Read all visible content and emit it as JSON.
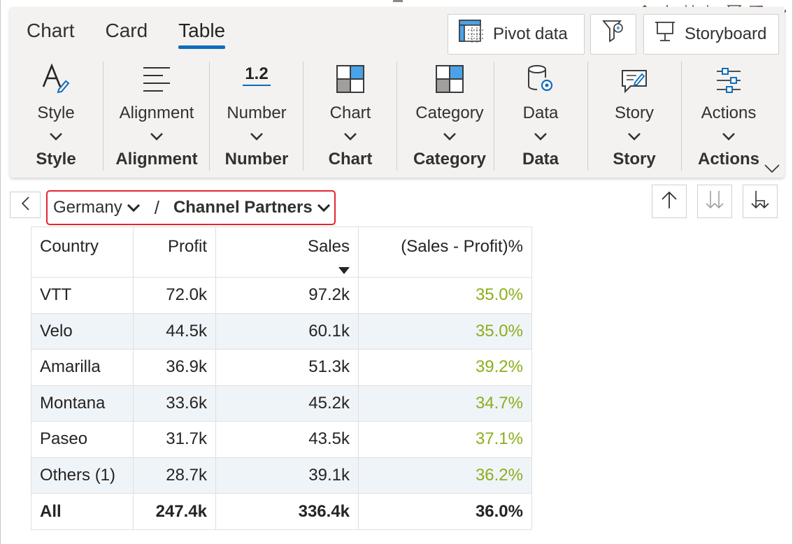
{
  "tabs": [
    {
      "label": "Chart"
    },
    {
      "label": "Card"
    },
    {
      "label": "Table"
    }
  ],
  "toolbar": {
    "pivot_label": "Pivot  data",
    "storyboard_label": "Storyboard"
  },
  "groups": [
    {
      "label": "Style",
      "name": "Style",
      "icon": "style-pen-icon"
    },
    {
      "label": "Alignment",
      "name": "Alignment",
      "icon": "align-left-icon"
    },
    {
      "label": "Number",
      "name": "Number",
      "icon_text": "1.2"
    },
    {
      "label": "Chart",
      "name": "Chart",
      "icon": "grid-chart-icon"
    },
    {
      "label": "Category",
      "name": "Category",
      "icon": "grid-category-icon"
    },
    {
      "label": "Data",
      "name": "Data",
      "icon": "database-gear-icon"
    },
    {
      "label": "Story",
      "name": "Story",
      "icon": "comment-edit-icon"
    },
    {
      "label": "Actions",
      "name": "Actions",
      "icon": "sliders-icon"
    }
  ],
  "breadcrumb": {
    "level1": "Germany",
    "separator": "/",
    "level2": "Channel Partners"
  },
  "table": {
    "headers": [
      "Country",
      "Profit",
      "Sales",
      "(Sales - Profit)%"
    ],
    "rows": [
      [
        "VTT",
        "72.0k",
        "97.2k",
        "35.0%"
      ],
      [
        "Velo",
        "44.5k",
        "60.1k",
        "35.0%"
      ],
      [
        "Amarilla",
        "36.9k",
        "51.3k",
        "39.2%"
      ],
      [
        "Montana",
        "33.6k",
        "45.2k",
        "34.7%"
      ],
      [
        "Paseo",
        "31.7k",
        "43.5k",
        "37.1%"
      ],
      [
        "Others (1)",
        "28.7k",
        "39.1k",
        "36.2%"
      ]
    ],
    "total": [
      "All",
      "247.4k",
      "336.4k",
      "36.0%"
    ]
  },
  "colors": {
    "accent": "#0f6cbd",
    "highlight_border": "#e5262d",
    "positive_pct": "#8aaf1a",
    "alt_row": "#eff4f8"
  }
}
